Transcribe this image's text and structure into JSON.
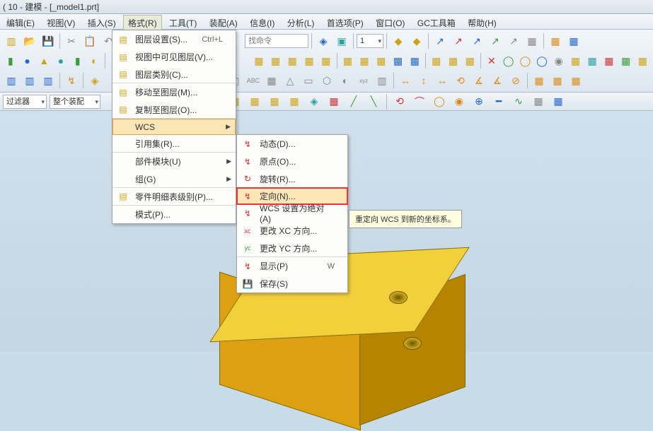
{
  "title": "( 10 - 建模 - [_model1.prt]",
  "menu": {
    "items": [
      "编辑(E)",
      "视图(V)",
      "插入(S)",
      "格式(R)",
      "工具(T)",
      "装配(A)",
      "信息(I)",
      "分析(L)",
      "首选项(P)",
      "窗口(O)",
      "GC工具箱",
      "帮助(H)"
    ],
    "active_index": 3
  },
  "search_placeholder": "找命令",
  "number_box": "1",
  "filter": {
    "label": "过滤器",
    "scope": "整个装配"
  },
  "format_menu": [
    {
      "label": "图层设置(S)...",
      "accel": "Ctrl+L"
    },
    {
      "label": "视图中可见图层(V)..."
    },
    {
      "label": "图层类别(C)...",
      "sep_below": true
    },
    {
      "label": "移动至图层(M)..."
    },
    {
      "label": "复制至图层(O)...",
      "sep_below": true
    },
    {
      "label": "WCS",
      "submenu": true,
      "hover": true
    },
    {
      "label": "引用集(R)...",
      "sep_below": true
    },
    {
      "label": "部件模块(U)",
      "submenu": true
    },
    {
      "label": "组(G)",
      "submenu": true,
      "sep_below": true
    },
    {
      "label": "零件明细表级别(P)...",
      "sep_below": true
    },
    {
      "label": "模式(P)..."
    }
  ],
  "wcs_menu": [
    {
      "label": "动态(D)..."
    },
    {
      "label": "原点(O)..."
    },
    {
      "label": "旋转(R)...",
      "sep_below": true
    },
    {
      "label": "定向(N)...",
      "highlight": true
    },
    {
      "label": "WCS 设置为绝对(A)"
    },
    {
      "label": "更改 XC 方向..."
    },
    {
      "label": "更改 YC 方向...",
      "sep_below": true
    },
    {
      "label": "显示(P)",
      "accel": "W"
    },
    {
      "label": "保存(S)"
    }
  ],
  "tooltip": "重定向 WCS 到新的坐标系。"
}
